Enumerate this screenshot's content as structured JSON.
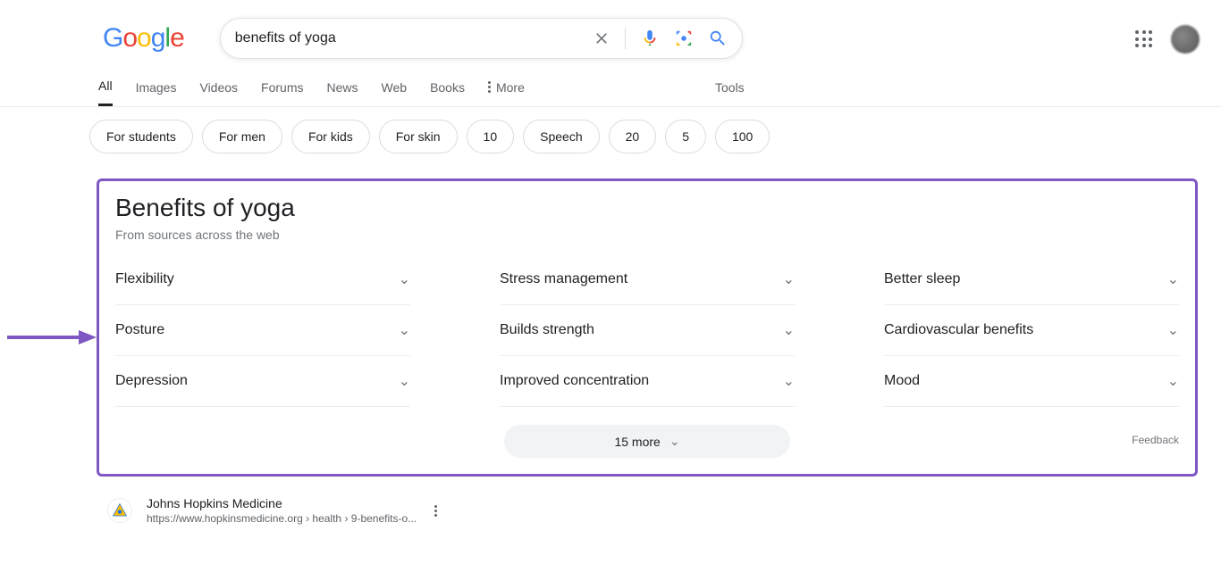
{
  "search": {
    "query": "benefits of yoga"
  },
  "tabs": [
    "All",
    "Images",
    "Videos",
    "Forums",
    "News",
    "Web",
    "Books"
  ],
  "more_label": "More",
  "tools_label": "Tools",
  "chips": [
    "For students",
    "For men",
    "For kids",
    "For skin",
    "10",
    "Speech",
    "20",
    "5",
    "100"
  ],
  "featured": {
    "title": "Benefits of yoga",
    "subtitle": "From sources across the web",
    "items": [
      "Flexibility",
      "Stress management",
      "Better sleep",
      "Posture",
      "Builds strength",
      "Cardiovascular benefits",
      "Depression",
      "Improved concentration",
      "Mood"
    ],
    "more_btn": "15 more",
    "feedback": "Feedback"
  },
  "result": {
    "site": "Johns Hopkins Medicine",
    "url": "https://www.hopkinsmedicine.org › health › 9-benefits-o..."
  }
}
